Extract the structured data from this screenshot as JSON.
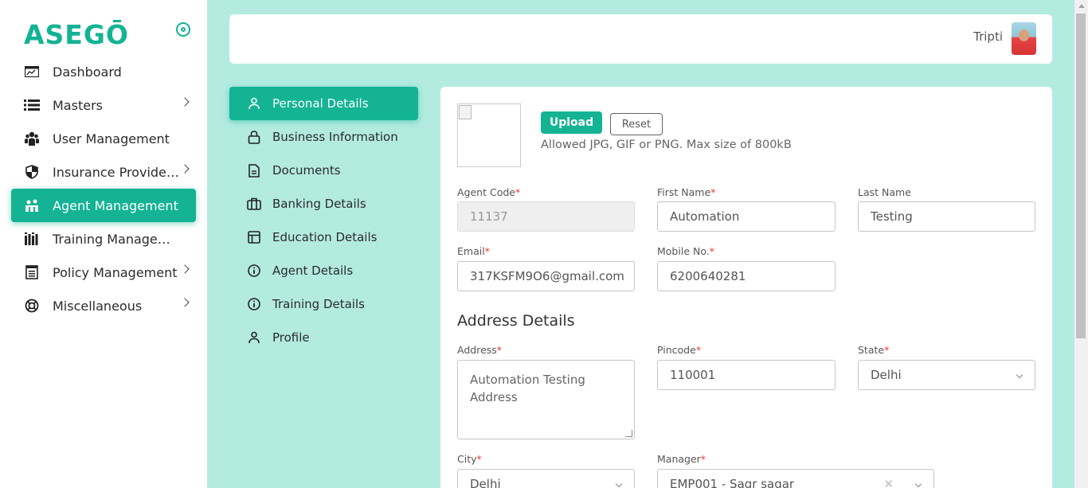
{
  "brand": {
    "logo_text": "ASEGŌ"
  },
  "sidebar": {
    "items": [
      {
        "label": "Dashboard",
        "icon": "dashboard-icon",
        "has_submenu": false,
        "active": false
      },
      {
        "label": "Masters",
        "icon": "list-icon",
        "has_submenu": true,
        "active": false
      },
      {
        "label": "User Management",
        "icon": "users-icon",
        "has_submenu": false,
        "active": false
      },
      {
        "label": "Insurance Provider ...",
        "icon": "shield-icon",
        "has_submenu": true,
        "active": false
      },
      {
        "label": "Agent Management",
        "icon": "agent-icon",
        "has_submenu": false,
        "active": true
      },
      {
        "label": "Training Managem...",
        "icon": "books-icon",
        "has_submenu": false,
        "active": false
      },
      {
        "label": "Policy Management",
        "icon": "document-icon",
        "has_submenu": true,
        "active": false
      },
      {
        "label": "Miscellaneous",
        "icon": "lifebuoy-icon",
        "has_submenu": true,
        "active": false
      }
    ]
  },
  "header": {
    "user_name": "Tripti"
  },
  "tabs": [
    {
      "label": "Personal Details",
      "icon": "user-icon",
      "active": true
    },
    {
      "label": "Business Information",
      "icon": "lock-icon",
      "active": false
    },
    {
      "label": "Documents",
      "icon": "file-icon",
      "active": false
    },
    {
      "label": "Banking Details",
      "icon": "briefcase-icon",
      "active": false
    },
    {
      "label": "Education Details",
      "icon": "layout-icon",
      "active": false
    },
    {
      "label": "Agent Details",
      "icon": "info-icon",
      "active": false
    },
    {
      "label": "Training Details",
      "icon": "info-icon",
      "active": false
    },
    {
      "label": "Profile",
      "icon": "user-icon",
      "active": false
    }
  ],
  "form": {
    "upload_label": "Upload",
    "reset_label": "Reset",
    "upload_hint": "Allowed JPG, GIF or PNG. Max size of 800kB",
    "agent_code": {
      "label": "Agent Code",
      "value": "11137"
    },
    "first_name": {
      "label": "First Name",
      "value": "Automation"
    },
    "last_name": {
      "label": "Last Name",
      "value": "Testing"
    },
    "email": {
      "label": "Email",
      "value": "317KSFM9O6@gmail.com"
    },
    "mobile": {
      "label": "Mobile No.",
      "value": "6200640281"
    },
    "address_section_title": "Address Details",
    "address": {
      "label": "Address",
      "value": "Automation Testing\nAddress"
    },
    "pincode": {
      "label": "Pincode",
      "value": "110001"
    },
    "state": {
      "label": "State",
      "value": "Delhi"
    },
    "city": {
      "label": "City",
      "value": "Delhi"
    },
    "manager": {
      "label": "Manager",
      "value": "EMP001 - Sagr sagar"
    }
  },
  "colors": {
    "accent": "#13b394",
    "background": "#b3ebe1",
    "required": "#e53935"
  }
}
